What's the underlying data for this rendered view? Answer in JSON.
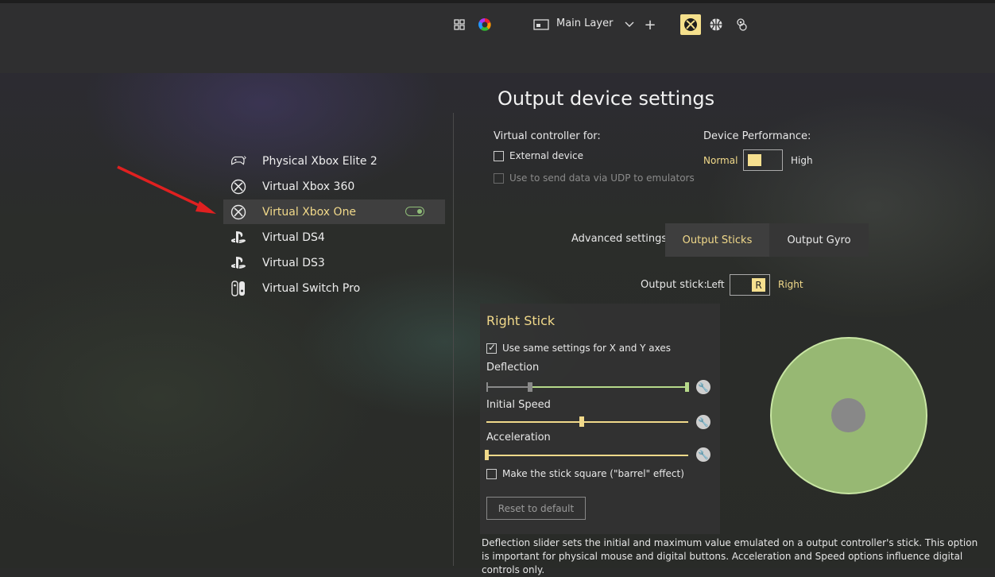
{
  "topbar": {
    "layer_label": "Main Layer",
    "icons": [
      "grid-icon",
      "color-wheel-icon",
      "layer-icon",
      "chevron-down-icon",
      "plus-icon",
      "xbox-icon",
      "basketball-icon",
      "gamepad-icon"
    ],
    "plus": "+",
    "chevron": "⌄"
  },
  "devices": [
    {
      "label": "Physical Xbox Elite 2",
      "icon": "elite-controller-icon"
    },
    {
      "label": "Virtual Xbox 360",
      "icon": "xbox-icon"
    },
    {
      "label": "Virtual Xbox One",
      "icon": "xbox-icon",
      "active": true
    },
    {
      "label": "Virtual DS4",
      "icon": "playstation-icon"
    },
    {
      "label": "Virtual DS3",
      "icon": "playstation-icon"
    },
    {
      "label": "Virtual Switch Pro",
      "icon": "switch-icon"
    }
  ],
  "settings": {
    "title": "Output device settings",
    "virtual_for": "Virtual controller for:",
    "external_device": "External device",
    "udp": "Use to send data via UDP to emulators",
    "device_performance": "Device Performance:",
    "perf_normal": "Normal",
    "perf_high": "High",
    "advanced": "Advanced settings:",
    "tab_sticks": "Output Sticks",
    "tab_gyro": "Output Gyro",
    "output_stick": "Output stick:",
    "stick_left": "Left",
    "stick_right": "Right",
    "stick_value": "R"
  },
  "right_stick": {
    "title": "Right Stick",
    "same_settings": "Use same settings for X and Y axes",
    "deflection": "Deflection",
    "initial_speed": "Initial Speed",
    "acceleration": "Acceleration",
    "barrel": "Make the stick square (\"barrel\" effect)",
    "reset": "Reset to default",
    "deflection_min": 0.22,
    "deflection_max": 1.0,
    "initial_speed_value": 0.47,
    "acceleration_value": 0.0
  },
  "info_text": "Deflection slider sets the initial and maximum value emulated on a output controller's stick. This option is important for physical mouse and digital buttons. Acceleration and Speed options influence digital controls only.",
  "colors": {
    "accent": "#f1d98a",
    "green": "#97b873"
  }
}
